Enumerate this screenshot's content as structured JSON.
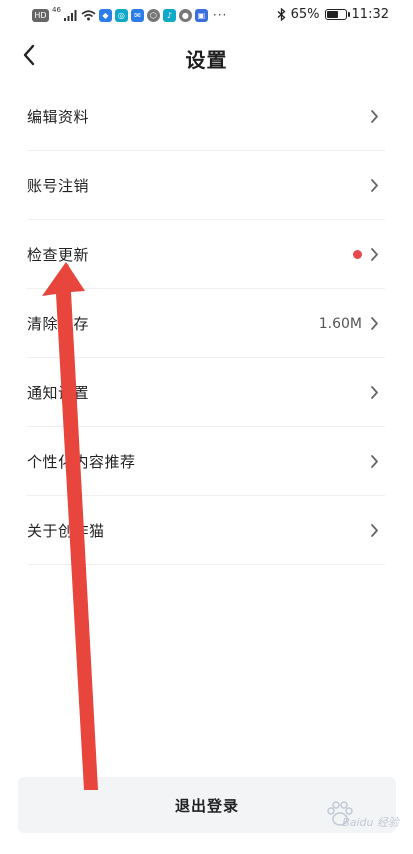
{
  "status_bar": {
    "left_labels": [
      "HD",
      "46"
    ],
    "battery_text": "65%",
    "battery_level": 0.65,
    "time": "11:32",
    "icons": [
      "hd-badge-icon",
      "signal-icon",
      "wifi-icon",
      "app-notification-icons",
      "more-icon",
      "bluetooth-icon",
      "battery-icon"
    ]
  },
  "header": {
    "title": "设置",
    "back_icon": "chevron-left-icon"
  },
  "settings": {
    "items": [
      {
        "label": "编辑资料",
        "value": "",
        "badge": false
      },
      {
        "label": "账号注销",
        "value": "",
        "badge": false
      },
      {
        "label": "检查更新",
        "value": "",
        "badge": true
      },
      {
        "label": "清除缓存",
        "value": "1.60M",
        "badge": false
      },
      {
        "label": "通知设置",
        "value": "",
        "badge": false
      },
      {
        "label": "个性化内容推荐",
        "value": "",
        "badge": false
      },
      {
        "label": "关于创作猫",
        "value": "",
        "badge": false
      }
    ]
  },
  "footer": {
    "logout_label": "退出登录"
  },
  "watermark": {
    "text": "Baidu 经验"
  },
  "colors": {
    "background": "#ffffff",
    "badge_red": "#e5484d",
    "annotation_arrow": "#e8453c",
    "logout_bg": "#f3f4f6"
  }
}
